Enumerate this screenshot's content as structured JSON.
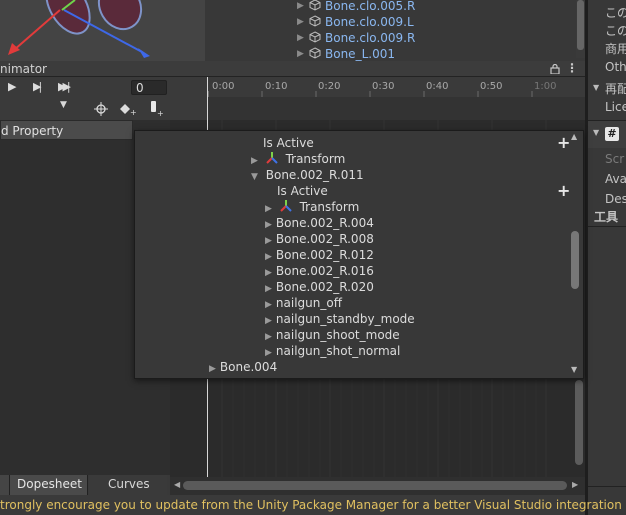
{
  "hierarchy": {
    "items": [
      {
        "label": "Bone.clo.005.R"
      },
      {
        "label": "Bone.clo.009.L"
      },
      {
        "label": "Bone.clo.009.R"
      },
      {
        "label": "Bone_L.001"
      }
    ]
  },
  "right_panel": {
    "line1": "この",
    "line2": "この",
    "line3": "商用",
    "line4": "Oth",
    "line5": "再配",
    "line6": "Lice",
    "line7": "Scr",
    "line8": "Ava",
    "line9": "Des",
    "line10": "工具"
  },
  "animator": {
    "title": "nimator",
    "frame_value": "0",
    "property_header": "d Property",
    "ruler_ticks": [
      "0:00",
      "0:10",
      "0:20",
      "0:30",
      "0:40",
      "0:50",
      "1:00"
    ]
  },
  "popup": {
    "rows": [
      {
        "label": "Is Active",
        "indent": 1,
        "tri": "",
        "icon": ""
      },
      {
        "label": "Transform",
        "indent": 1,
        "tri": "▶",
        "icon": "transform"
      },
      {
        "label": "Bone.002_R.011",
        "indent": 1,
        "tri": "▼",
        "icon": ""
      },
      {
        "label": "Is Active",
        "indent": 2,
        "tri": "",
        "icon": ""
      },
      {
        "label": "Transform",
        "indent": 2,
        "tri": "▶",
        "icon": "transform"
      },
      {
        "label": "Bone.002_R.004",
        "indent": 2,
        "tri": "▶",
        "icon": ""
      },
      {
        "label": "Bone.002_R.008",
        "indent": 2,
        "tri": "▶",
        "icon": ""
      },
      {
        "label": "Bone.002_R.012",
        "indent": 2,
        "tri": "▶",
        "icon": ""
      },
      {
        "label": "Bone.002_R.016",
        "indent": 2,
        "tri": "▶",
        "icon": ""
      },
      {
        "label": "Bone.002_R.020",
        "indent": 2,
        "tri": "▶",
        "icon": ""
      },
      {
        "label": "nailgun_off",
        "indent": 2,
        "tri": "▶",
        "icon": ""
      },
      {
        "label": "nailgun_standby_mode",
        "indent": 2,
        "tri": "▶",
        "icon": ""
      },
      {
        "label": "nailgun_shoot_mode",
        "indent": 2,
        "tri": "▶",
        "icon": ""
      },
      {
        "label": "nailgun_shot_normal",
        "indent": 2,
        "tri": "▶",
        "icon": ""
      },
      {
        "label": "Bone.004",
        "indent": 0,
        "tri": "▶",
        "icon": ""
      }
    ]
  },
  "tabs": {
    "dopesheet": "Dopesheet",
    "curves": "Curves"
  },
  "console": {
    "message": "trongly encourage you to update from the Unity Package Manager for a better Visual Studio integration"
  },
  "colors": {
    "bone_label": "#8ab7f0",
    "console_warning": "#e0c060",
    "scrollbar": "#777777"
  }
}
